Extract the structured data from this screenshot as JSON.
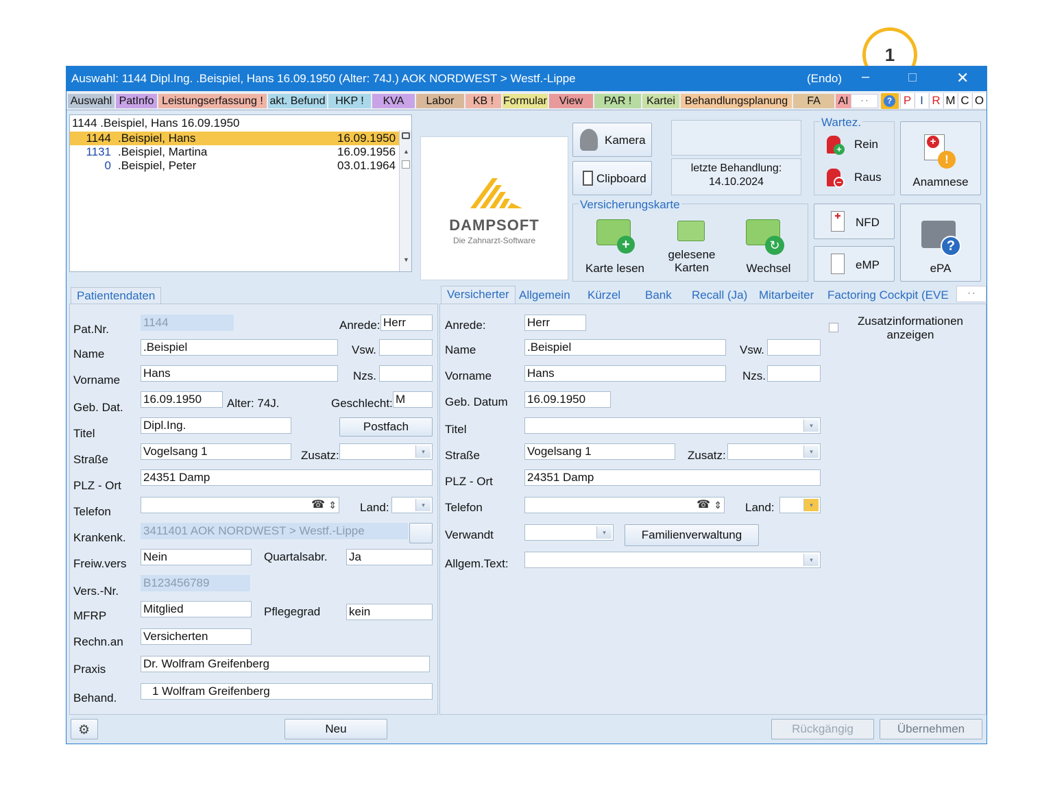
{
  "window": {
    "title": "Auswahl: 1144  Dipl.Ing. .Beispiel, Hans  16.09.1950 (Alter: 74J.)  AOK NORDWEST > Westf.-Lippe",
    "mode": "(Endo)",
    "minimize": "–",
    "close": "✕"
  },
  "callout": {
    "number": "1"
  },
  "menu_tabs": [
    {
      "label": "Auswahl",
      "color": "#b9c6d6"
    },
    {
      "label": "PatInfo",
      "color": "#c9a3e8"
    },
    {
      "label": "Leistungserfassung !",
      "color": "#f0b4a6"
    },
    {
      "label": "akt. Befund",
      "color": "#a9d8ea"
    },
    {
      "label": "HKP !",
      "color": "#a9d8ea"
    },
    {
      "label": "KVA",
      "color": "#c9a3e8"
    },
    {
      "label": "Labor",
      "color": "#d9b89a"
    },
    {
      "label": "KB !",
      "color": "#f0b4a6"
    },
    {
      "label": "Formular",
      "color": "#e8e48f"
    },
    {
      "label": "View",
      "color": "#e89a9a"
    },
    {
      "label": "PAR !",
      "color": "#b7dba0"
    },
    {
      "label": "Kartei",
      "color": "#c8e0a6"
    },
    {
      "label": "Behandlungsplanung",
      "color": "#f3c79a"
    },
    {
      "label": "FA",
      "color": "#e0c39a"
    },
    {
      "label": "AI",
      "color": "#f3a3a3"
    }
  ],
  "mode_letters": [
    "P",
    "I",
    "R",
    "M",
    "C",
    "O"
  ],
  "patient_list": {
    "header": "1144 .Beispiel, Hans  16.09.1950",
    "rows": [
      {
        "nr": "1144",
        "name": ".Beispiel, Hans",
        "date": "16.09.1950",
        "selected": true
      },
      {
        "nr": "1131",
        "name": ".Beispiel, Martina",
        "date": "16.09.1956",
        "selected": false
      },
      {
        "nr": "0",
        "name": ".Beispiel, Peter",
        "date": "03.01.1964",
        "selected": false
      }
    ]
  },
  "logo": {
    "brand": "DAMPSOFT",
    "tagline": "Die Zahnarzt-Software"
  },
  "buttons": {
    "kamera": "Kamera",
    "clipboard": "Clipboard",
    "karte_lesen": "Karte lesen",
    "gelesene_karten": "gelesene Karten",
    "wechsel": "Wechsel",
    "rein": "Rein",
    "raus": "Raus",
    "anamnese": "Anamnese",
    "nfd": "NFD",
    "emp": "eMP",
    "epa": "ePA",
    "postfach": "Postfach",
    "familienverwaltung": "Familienverwaltung",
    "neu": "Neu",
    "rueckgaengig": "Rückgängig",
    "uebernehmen": "Übernehmen"
  },
  "last_treatment": {
    "label": "letzte Behandlung:",
    "date": "14.10.2024"
  },
  "groups": {
    "versichertenkarte": "Versicherungskarte",
    "wartez": "Wartez."
  },
  "left_tabs": [
    "Patientendaten"
  ],
  "right_tabs": [
    "Versicherter",
    "Allgemein",
    "Kürzel",
    "Bank",
    "Recall (Ja)",
    "Mitarbeiter",
    "Factoring Cockpit (EVE"
  ],
  "patient": {
    "labels": {
      "patnr": "Pat.Nr.",
      "name": "Name",
      "vorname": "Vorname",
      "gebdat": "Geb. Dat.",
      "titel": "Titel",
      "strasse": "Straße",
      "plzort": "PLZ - Ort",
      "telefon": "Telefon",
      "krankenk": "Krankenk.",
      "freiwvers": "Freiw.vers",
      "versnr": "Vers.-Nr.",
      "mfrp": "MFRP",
      "rechnan": "Rechn.an",
      "praxis": "Praxis",
      "behand": "Behand.",
      "anrede": "Anrede:",
      "vsw": "Vsw.",
      "nzs": "Nzs.",
      "alter": "Alter: 74J.",
      "geschlecht": "Geschlecht:",
      "zusatz": "Zusatz:",
      "land": "Land:",
      "quartalsabr": "Quartalsabr.",
      "pflegegrad": "Pflegegrad"
    },
    "values": {
      "patnr": "1144",
      "anrede": "Herr",
      "name": ".Beispiel",
      "vorname": "Hans",
      "gebdat": "16.09.1950",
      "geschlecht": "M",
      "titel": "Dipl.Ing.",
      "strasse": "Vogelsang 1",
      "plzort": "24351 Damp",
      "krankenk": "3411401 AOK NORDWEST > Westf.-Lippe",
      "freiwvers": "Nein",
      "quartalsabr": "Ja",
      "versnr": "B123456789",
      "mfrp": "Mitglied",
      "pflegegrad": "kein",
      "rechnan": "Versicherten",
      "praxis": "Dr. Wolfram Greifenberg",
      "behand": "1 Wolfram Greifenberg"
    }
  },
  "insured": {
    "labels": {
      "anrede": "Anrede:",
      "name": "Name",
      "vorname": "Vorname",
      "gebdatum": "Geb. Datum",
      "titel": "Titel",
      "strasse": "Straße",
      "plzort": "PLZ - Ort",
      "telefon": "Telefon",
      "verwandt": "Verwandt",
      "allgemtext": "Allgem.Text:",
      "vsw": "Vsw.",
      "nzs": "Nzs.",
      "zusatz": "Zusatz:",
      "land": "Land:",
      "zusatzinfo": "Zusatzinformationen anzeigen"
    },
    "values": {
      "anrede": "Herr",
      "name": ".Beispiel",
      "vorname": "Hans",
      "gebdatum": "16.09.1950",
      "strasse": "Vogelsang 1",
      "plzort": "24351 Damp"
    }
  },
  "colors": {
    "titlebar": "#1a7bd4",
    "accent": "#f5b820",
    "selected_row": "#f5c64a",
    "link_blue": "#2a6cc0"
  }
}
